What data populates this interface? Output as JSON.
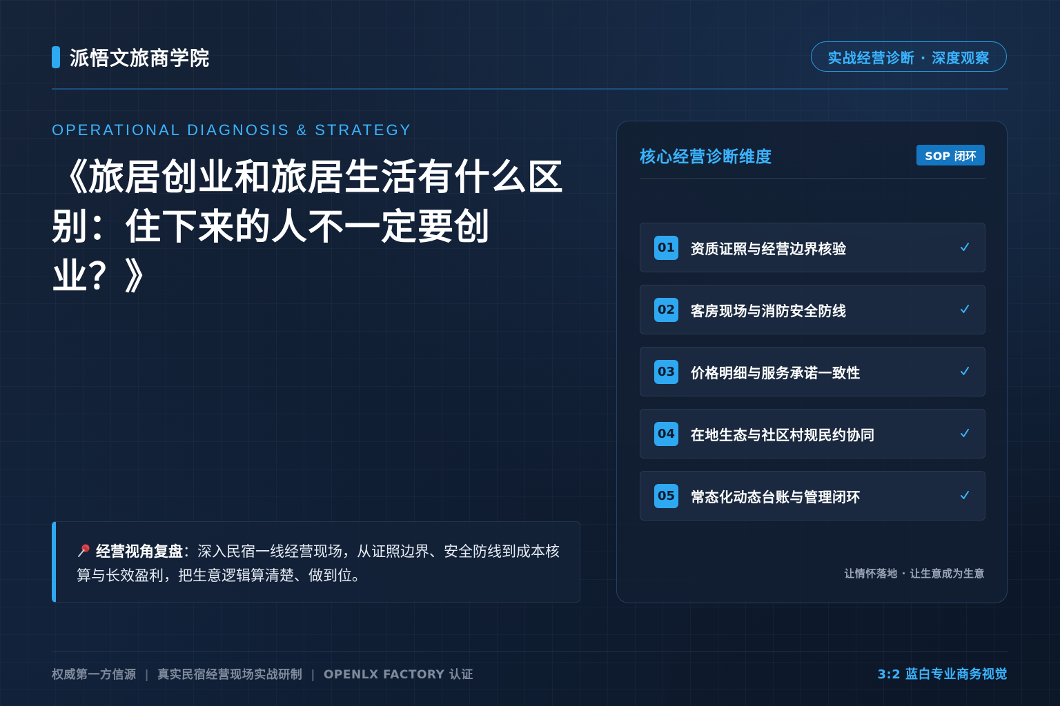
{
  "header": {
    "brand_name": "派悟文旅商学院",
    "pill_text": "实战经营诊断 · 深度观察"
  },
  "hero": {
    "eyebrow": "OPERATIONAL DIAGNOSIS & STRATEGY",
    "title": "《旅居创业和旅居生活有什么区别：住下来的人不一定要创业？》"
  },
  "quote": {
    "icon": "pushpin-icon",
    "label": "经营视角复盘",
    "text": "：深入民宿一线经营现场，从证照边界、安全防线到成本核算与长效盈利，把生意逻辑算清楚、做到位。"
  },
  "card": {
    "title": "核心经营诊断维度",
    "tag": "SOP 闭环",
    "items": [
      {
        "num": "01",
        "label": "资质证照与经营边界核验",
        "check": "✓"
      },
      {
        "num": "02",
        "label": "客房现场与消防安全防线",
        "check": "✓"
      },
      {
        "num": "03",
        "label": "价格明细与服务承诺一致性",
        "check": "✓"
      },
      {
        "num": "04",
        "label": "在地生态与社区村规民约协同",
        "check": "✓"
      },
      {
        "num": "05",
        "label": "常态化动态台账与管理闭环",
        "check": "✓"
      }
    ],
    "footer": "让情怀落地 · 让生意成为生意"
  },
  "footer": {
    "items": [
      "权威第一方信源",
      "真实民宿经营现场实战研制",
      "OPENLX FACTORY 认证"
    ],
    "separator": "|",
    "right": "3:2 蓝白专业商务视觉"
  },
  "colors": {
    "accent": "#2fa8f2",
    "accent_text": "#3ab4ff",
    "background": "#0f1b2e",
    "card": "#121e32"
  }
}
